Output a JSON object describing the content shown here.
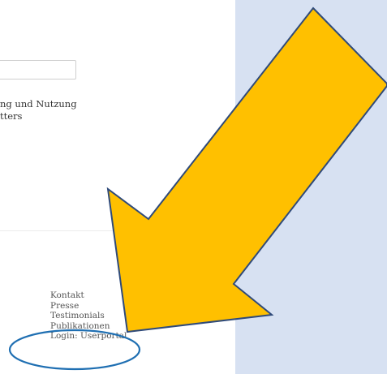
{
  "newsletter": {
    "email_value": "",
    "consent_line_1": "ng und Nutzung",
    "consent_line_2": "tters"
  },
  "footer": {
    "links": [
      "Kontakt",
      "Presse",
      "Testimonials",
      "Publikationen",
      "Login: Userportal"
    ]
  },
  "annotation": {
    "arrow_color": "#ffc000",
    "arrow_outline_color": "#2f4a7a",
    "highlight_ellipse_color": "#1f6fb2",
    "side_panel_color": "#d7e1f2"
  }
}
